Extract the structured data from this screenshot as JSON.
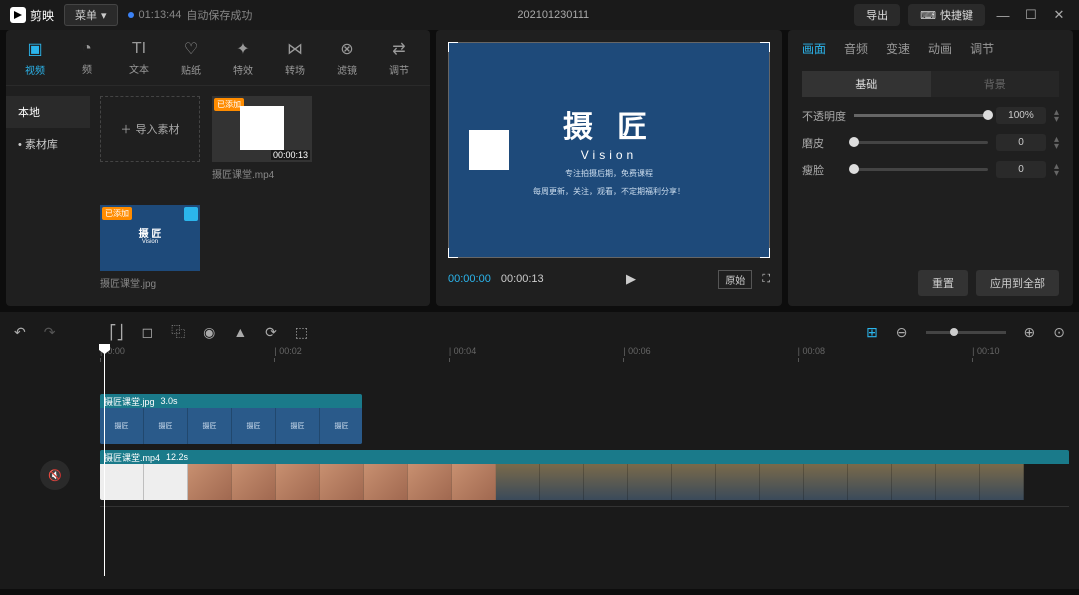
{
  "titlebar": {
    "app_name": "剪映",
    "menu_label": "菜单",
    "autosave_time": "01:13:44",
    "autosave_text": "自动保存成功",
    "project_name": "202101230111",
    "export_label": "导出",
    "shortcut_label": "快捷键"
  },
  "media_tabs": [
    {
      "icon": "▸",
      "label": "视频",
      "active": true
    },
    {
      "icon": "◔",
      "label": "频"
    },
    {
      "icon": "TI",
      "label": "文本"
    },
    {
      "icon": "♡",
      "label": "贴纸"
    },
    {
      "icon": "✦",
      "label": "特效"
    },
    {
      "icon": "⋈",
      "label": "转场"
    },
    {
      "icon": "⊗",
      "label": "滤镜"
    },
    {
      "icon": "⇄",
      "label": "调节"
    }
  ],
  "media_side": [
    {
      "label": "本地",
      "active": true
    },
    {
      "label": "• 素材库"
    }
  ],
  "import_label": "导入素材",
  "media_items": [
    {
      "name": "摄匠课堂.mp4",
      "badge": "已添加",
      "duration": "00:00:13",
      "type": "video"
    },
    {
      "name": "摄匠课堂.jpg",
      "badge": "已添加",
      "type": "image"
    }
  ],
  "preview": {
    "title": "摄 匠",
    "subtitle": "Vision",
    "line1": "专注拍摄后期，免费课程",
    "line2": "每周更新，关注，观看，不定期福利分享！",
    "time_current": "00:00:00",
    "time_total": "00:00:13",
    "ratio": "原始"
  },
  "props": {
    "tabs": [
      "画面",
      "音频",
      "变速",
      "动画",
      "调节"
    ],
    "active_tab": 0,
    "sub_tabs": [
      "基础",
      "背景"
    ],
    "opacity_label": "不透明度",
    "opacity_value": "100%",
    "opacity_pct": 100,
    "skin_label": "磨皮",
    "skin_value": "0",
    "skin_pct": 0,
    "face_label": "瘦脸",
    "face_value": "0",
    "face_pct": 0,
    "reset_label": "重置",
    "apply_label": "应用到全部"
  },
  "timeline": {
    "ruler": [
      "00:00",
      "00:02",
      "00:04",
      "00:06",
      "00:08",
      "00:10"
    ],
    "clip1": {
      "name": "摄匠课堂.jpg",
      "dur": "3.0s"
    },
    "clip2": {
      "name": "摄匠课堂.mp4",
      "dur": "12.2s"
    }
  }
}
